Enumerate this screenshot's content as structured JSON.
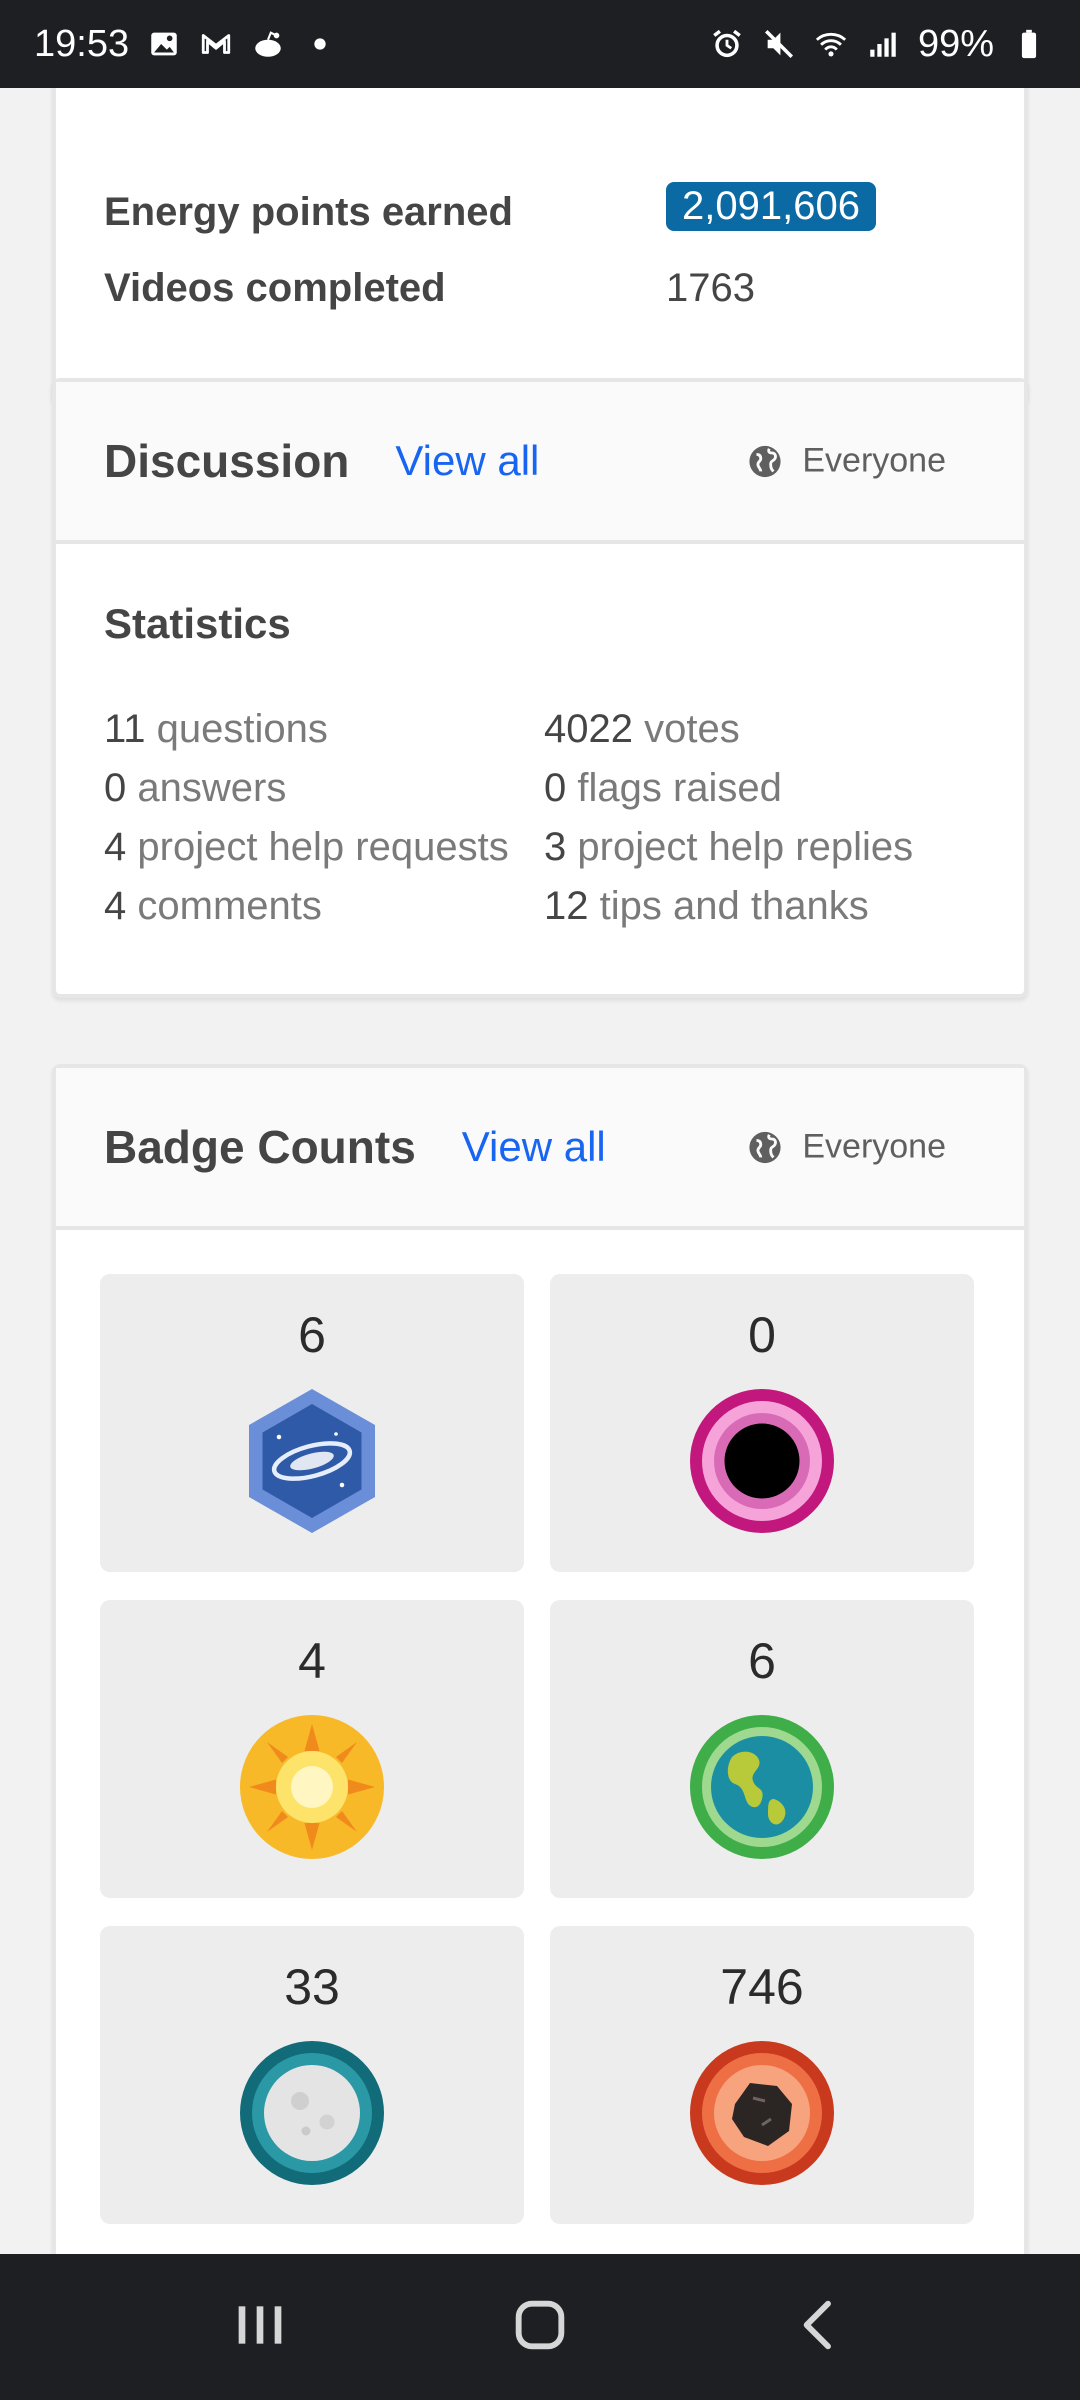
{
  "status_bar": {
    "time": "19:53",
    "battery": "99%",
    "left_icons": [
      "gallery-icon",
      "gmail-icon",
      "reddit-icon",
      "dot-icon"
    ],
    "right_icons": [
      "alarm-icon",
      "mute-icon",
      "wifi-icon",
      "signal-icon",
      "battery-icon"
    ]
  },
  "stats_card": {
    "rows": [
      {
        "label": "Energy points earned",
        "value": "2,091,606"
      },
      {
        "label": "Videos completed",
        "value": "1763"
      }
    ]
  },
  "discussion": {
    "title": "Discussion",
    "view_all": "View all",
    "visibility": "Everyone",
    "statistics_title": "Statistics",
    "stats": [
      {
        "num": "11",
        "label": "questions"
      },
      {
        "num": "4022",
        "label": "votes"
      },
      {
        "num": "0",
        "label": "answers"
      },
      {
        "num": "0",
        "label": "flags raised"
      },
      {
        "num": "4",
        "label": "project help requests"
      },
      {
        "num": "3",
        "label": "project help replies"
      },
      {
        "num": "4",
        "label": "comments"
      },
      {
        "num": "12",
        "label": "tips and thanks"
      }
    ]
  },
  "badges": {
    "title": "Badge Counts",
    "view_all": "View all",
    "visibility": "Everyone",
    "items": [
      {
        "count": "6",
        "icon": "galaxy-badge-icon"
      },
      {
        "count": "0",
        "icon": "black-hole-badge-icon"
      },
      {
        "count": "4",
        "icon": "sun-badge-icon"
      },
      {
        "count": "6",
        "icon": "earth-badge-icon"
      },
      {
        "count": "33",
        "icon": "moon-badge-icon"
      },
      {
        "count": "746",
        "icon": "meteorite-badge-icon"
      }
    ]
  },
  "colors": {
    "accent_link": "#1865f2",
    "energy_badge": "#0b6aa3",
    "system_bar": "#1e1f23"
  },
  "nav_bar": {
    "buttons": [
      "recent-apps-icon",
      "home-icon",
      "back-icon"
    ]
  }
}
